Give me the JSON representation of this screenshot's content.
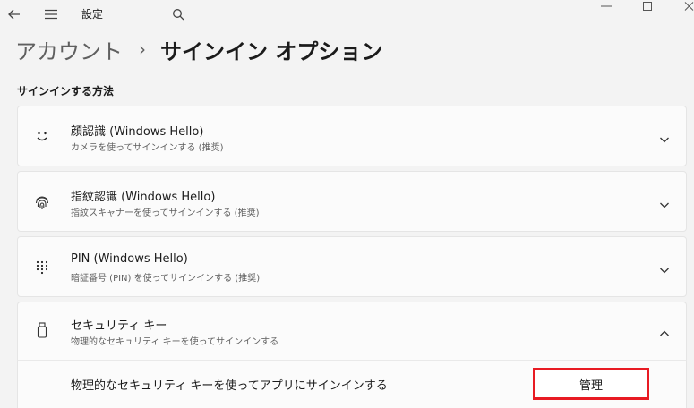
{
  "window": {
    "title": "設定"
  },
  "breadcrumb": {
    "parent": "アカウント",
    "separator": "›",
    "current": "サインイン オプション"
  },
  "section": {
    "title": "サインインする方法"
  },
  "methods": [
    {
      "title": "顔認識 (Windows Hello)",
      "subtitle": "カメラを使ってサインインする (推奨)",
      "icon": "face-icon",
      "expanded": false
    },
    {
      "title": "指紋認識 (Windows Hello)",
      "subtitle": "指紋スキャナーを使ってサインインする (推奨)",
      "icon": "fingerprint-icon",
      "expanded": false
    },
    {
      "title": "PIN (Windows Hello)",
      "subtitle": "暗証番号 (PIN) を使ってサインインする (推奨)",
      "icon": "keypad-icon",
      "expanded": false
    },
    {
      "title": "セキュリティ キー",
      "subtitle": "物理的なセキュリティ キーを使ってサインインする",
      "icon": "usb-key-icon",
      "expanded": true
    }
  ],
  "security_key_detail": {
    "label": "物理的なセキュリティ キーを使ってアプリにサインインする",
    "button": "管理"
  },
  "colors": {
    "highlight": "#e81b23",
    "background": "#f3f3f3",
    "card": "#fbfbfb"
  }
}
